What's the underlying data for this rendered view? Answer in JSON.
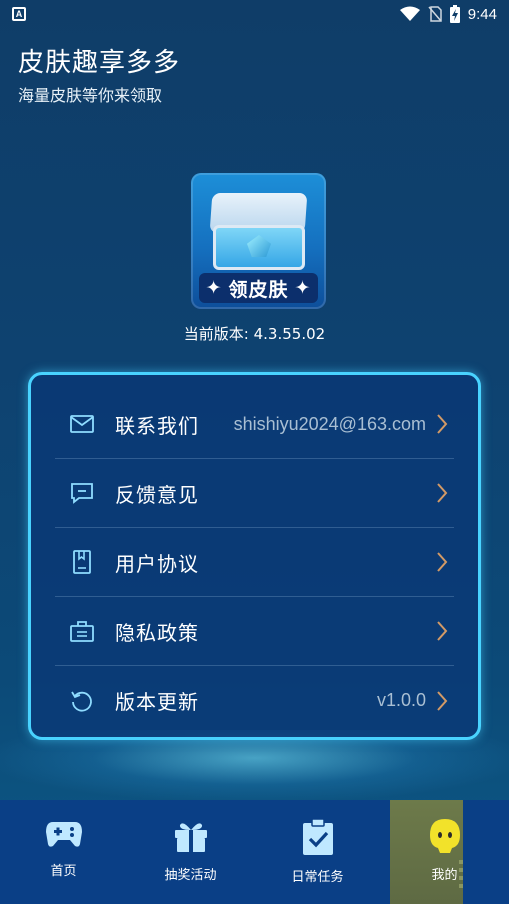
{
  "status_bar": {
    "left_icon": "A",
    "time": "9:44",
    "icons": [
      "wifi-icon",
      "sim-icon",
      "battery-charging-icon"
    ]
  },
  "header": {
    "title": "皮肤趣享多多",
    "subtitle": "海量皮肤等你来领取"
  },
  "app_logo": {
    "label": "领皮肤"
  },
  "version_text": "当前版本: 4.3.55.02",
  "menu": {
    "contact": {
      "label": "联系我们",
      "value": "shishiyu2024@163.com",
      "icon": "mail-icon"
    },
    "feedback": {
      "label": "反馈意见",
      "icon": "message-icon"
    },
    "agreement": {
      "label": "用户协议",
      "icon": "document-icon"
    },
    "privacy": {
      "label": "隐私政策",
      "icon": "briefcase-icon"
    },
    "update": {
      "label": "版本更新",
      "value": "v1.0.0",
      "icon": "refresh-icon"
    }
  },
  "tabs": [
    {
      "label": "首页",
      "icon": "gamepad-icon"
    },
    {
      "label": "抽奖活动",
      "icon": "gift-icon"
    },
    {
      "label": "日常任务",
      "icon": "clipboard-check-icon"
    },
    {
      "label": "我的",
      "icon": "avatar-face-icon",
      "active": true
    }
  ],
  "colors": {
    "accent_border": "#49d3ff",
    "chevron": "#d39a66",
    "tabbar_bg": "#0a3f86",
    "active_face": "#f2e22a"
  }
}
